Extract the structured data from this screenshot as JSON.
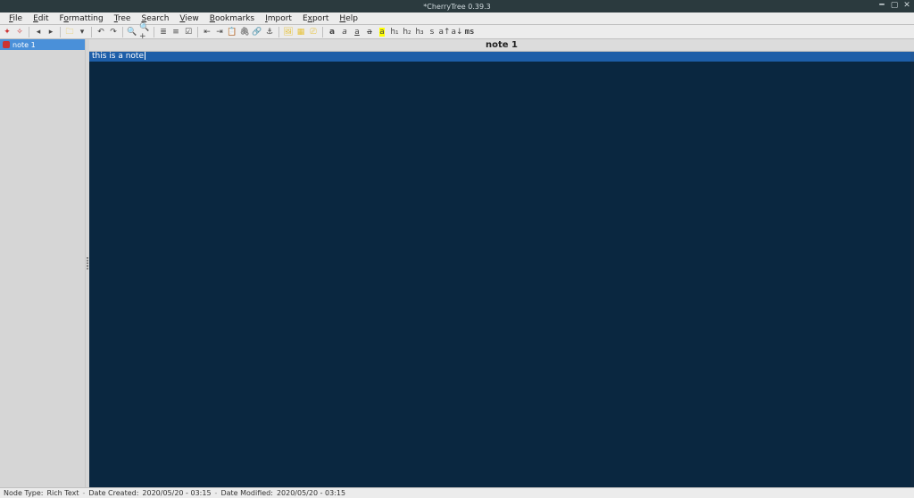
{
  "window": {
    "title": "*CherryTree 0.39.3"
  },
  "menu": {
    "items": [
      {
        "label": "File",
        "accel": "F"
      },
      {
        "label": "Edit",
        "accel": "E"
      },
      {
        "label": "Formatting",
        "accel": "o"
      },
      {
        "label": "Tree",
        "accel": "T"
      },
      {
        "label": "Search",
        "accel": "S"
      },
      {
        "label": "View",
        "accel": "V"
      },
      {
        "label": "Bookmarks",
        "accel": "B"
      },
      {
        "label": "Import",
        "accel": "I"
      },
      {
        "label": "Export",
        "accel": "x"
      },
      {
        "label": "Help",
        "accel": "H"
      }
    ]
  },
  "toolbar": {
    "groups": [
      [
        "node-add",
        "node-add-child"
      ],
      [
        "nav-back",
        "nav-forward"
      ],
      [
        "save",
        "dropdown"
      ],
      [
        "undo",
        "redo"
      ],
      [
        "zoom-reset",
        "zoom-in"
      ],
      [
        "list-bulleted",
        "list-numbered",
        "list-todo"
      ],
      [
        "indent-left",
        "indent-right",
        "paste",
        "attach",
        "link",
        "anchor"
      ],
      [
        "image",
        "table",
        "codebox"
      ],
      [
        "bold",
        "italic",
        "underline",
        "strikethrough",
        "highlight"
      ],
      [
        "h1",
        "h2",
        "h3"
      ],
      [
        "small",
        "superscript",
        "subscript",
        "monospace"
      ]
    ],
    "labels": {
      "bold": "a",
      "italic": "a",
      "underline": "a",
      "strikethrough": "a",
      "highlight": "a",
      "h1": "h₁",
      "h2": "h₂",
      "h3": "h₃",
      "small": "s",
      "superscript": "a↑",
      "subscript": "a↓",
      "monospace": "ms"
    },
    "colors": {
      "accent_yellow": "#e7c23b",
      "accent_red": "#c33",
      "chip": "#ffffff"
    }
  },
  "tree": {
    "items": [
      {
        "label": "note 1",
        "selected": true
      }
    ]
  },
  "editor": {
    "header": "note 1",
    "content": "this is a note",
    "current_line_bg": "#1d5ea8",
    "bg": "#0a2740",
    "fg": "#e6e6e6"
  },
  "statusbar": {
    "node_type_label": "Node Type:",
    "node_type_value": "Rich Text",
    "date_created_label": "Date Created:",
    "date_created_value": "2020/05/20 - 03:15",
    "date_modified_label": "Date Modified:",
    "date_modified_value": "2020/05/20 - 03:15"
  }
}
